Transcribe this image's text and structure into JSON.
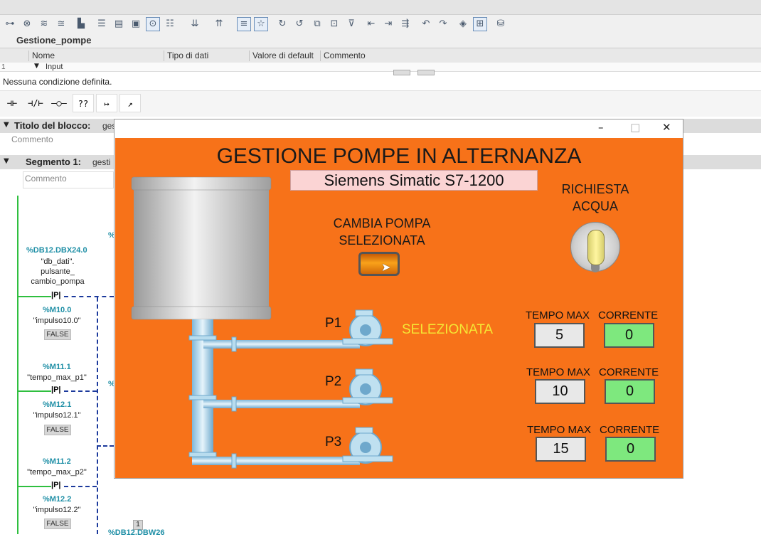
{
  "toolbar": {
    "icons": [
      "insert-network-icon",
      "delete-network-icon",
      "insert-row-icon",
      "add-row-icon",
      "copy-icon",
      "absolute-operands-icon",
      "network-comments-icon",
      "open-all-networks-icon",
      "favorites-icon",
      "show-comment-icon",
      "go-to-next-icon",
      "go-to-previous-icon",
      "download-icon",
      "upload-icon",
      "compare-icon",
      "monitoring-icon",
      "monitor-off-icon"
    ]
  },
  "block": {
    "name": "Gestione_pompe"
  },
  "interface": {
    "columns": [
      "Nome",
      "Tipo di dati",
      "Valore di default",
      "Commento"
    ],
    "row_index": "1",
    "row_name": "Input"
  },
  "condition": "Nessuna condizione definita.",
  "block_title": {
    "label": "Titolo del blocco:",
    "value": "ges",
    "comment": "Commento"
  },
  "segment": {
    "label": "Segmento 1:",
    "value": "gesti",
    "comment": "Commento"
  },
  "ladder": [
    {
      "address": "%DB12.DBX24.0",
      "tag": "\"db_dati\".\npulsante_\ncambio_pompa",
      "contact": "P"
    },
    {
      "address": "%M10.0",
      "tag": "\"impulso10.0\"",
      "value": "FALSE"
    },
    {
      "address": "%M11.1",
      "tag": "\"tempo_max_p1\"",
      "contact": "P"
    },
    {
      "address": "%M12.1",
      "tag": "\"impulso12.1\"",
      "value": "FALSE"
    },
    {
      "address": "%M11.2",
      "tag": "\"tempo_max_p2\"",
      "contact": "P"
    },
    {
      "address": "%M12.2",
      "tag": "\"impulso12.2\"",
      "value": "FALSE"
    }
  ],
  "ladder_bottom": {
    "number": "1",
    "address": "%DB12.DBW26"
  },
  "side_fragments": [
    "%",
    "%"
  ],
  "hmi": {
    "title": "GESTIONE POMPE IN ALTERNANZA",
    "plc_label": "Siemens Simatic S7-1200",
    "change_label": "CAMBIA POMPA SELEZIONATA",
    "request_label": "RICHIESTA ACQUA",
    "selected_text": "SELEZIONATA",
    "pumps": [
      {
        "name": "P1",
        "max_label": "TEMPO MAX",
        "current_label": "CORRENTE",
        "max_time": "5",
        "current": "0"
      },
      {
        "name": "P2",
        "max_label": "TEMPO MAX",
        "current_label": "CORRENTE",
        "max_time": "10",
        "current": "0"
      },
      {
        "name": "P3",
        "max_label": "TEMPO MAX",
        "current_label": "CORRENTE",
        "max_time": "15",
        "current": "0"
      }
    ],
    "colors": {
      "background": "#f77219",
      "selected": "#f5e634",
      "current_field": "#7ee87e",
      "plc_label_bg": "#fbd4d4"
    }
  }
}
